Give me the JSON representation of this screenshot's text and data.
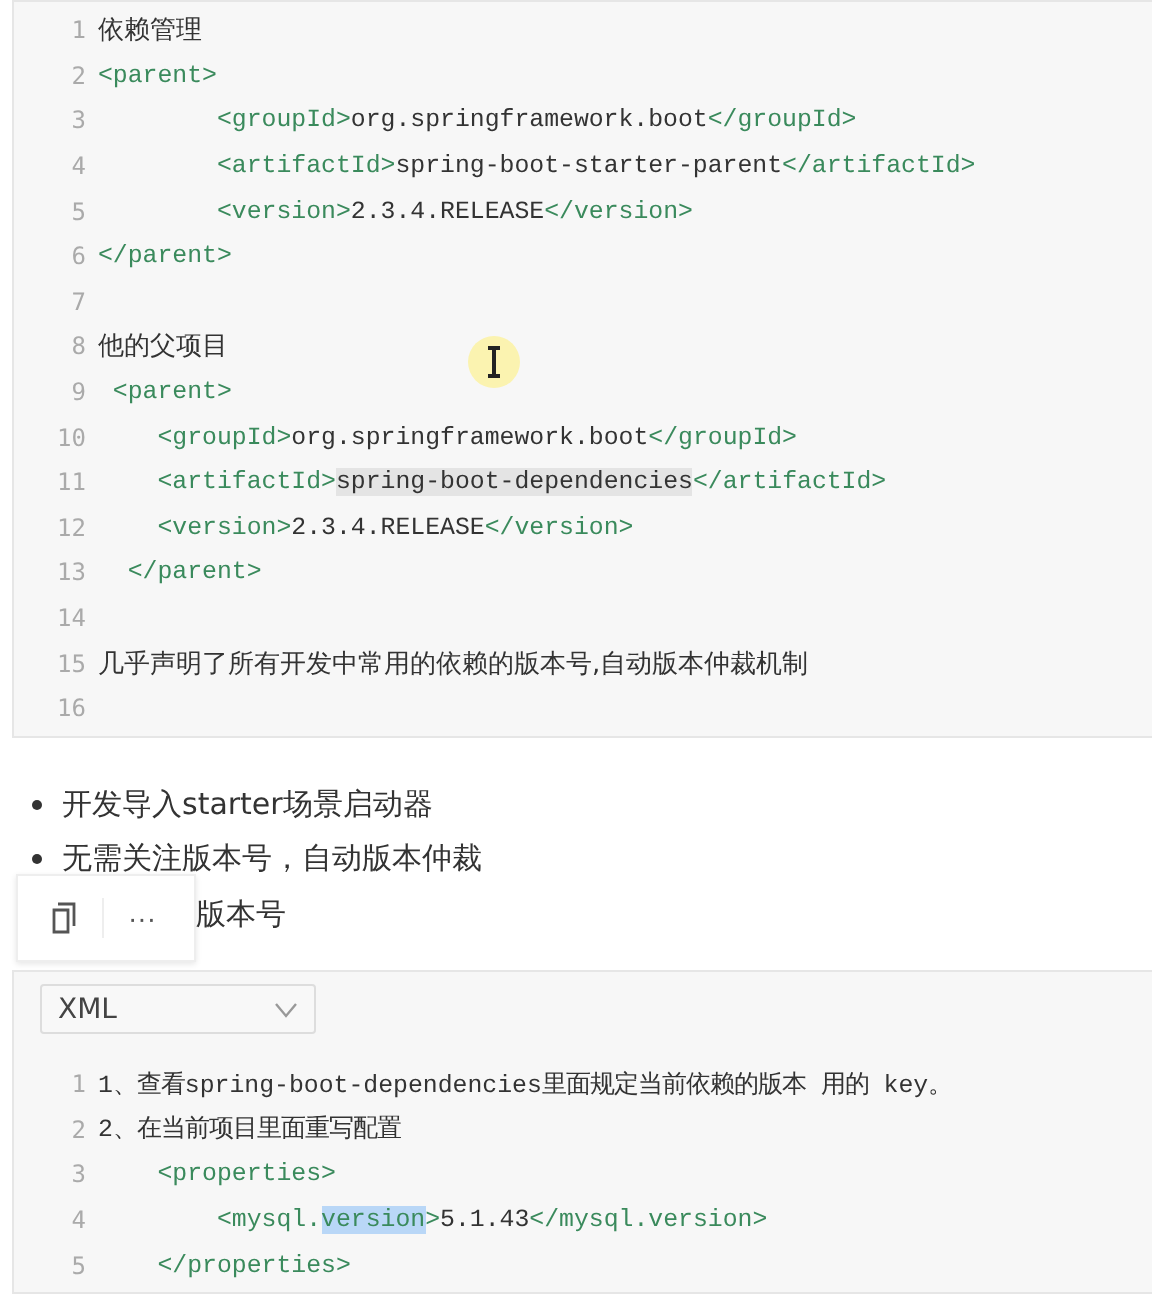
{
  "code_block_1": {
    "lines": [
      {
        "number": "1",
        "segments": [
          {
            "kind": "prose",
            "text": "依赖管理"
          }
        ]
      },
      {
        "number": "2",
        "segments": [
          {
            "kind": "tag",
            "text": "<parent>"
          }
        ]
      },
      {
        "number": "3",
        "segments": [
          {
            "kind": "tag",
            "text": "        <groupId>"
          },
          {
            "kind": "value",
            "text": "org.springframework.boot"
          },
          {
            "kind": "tag",
            "text": "</groupId>"
          }
        ]
      },
      {
        "number": "4",
        "segments": [
          {
            "kind": "tag",
            "text": "        <artifactId>"
          },
          {
            "kind": "value",
            "text": "spring-boot-starter-parent"
          },
          {
            "kind": "tag",
            "text": "</artifactId>"
          }
        ]
      },
      {
        "number": "5",
        "segments": [
          {
            "kind": "tag",
            "text": "        <version>"
          },
          {
            "kind": "value",
            "text": "2.3.4.RELEASE"
          },
          {
            "kind": "tag",
            "text": "</version>"
          }
        ]
      },
      {
        "number": "6",
        "segments": [
          {
            "kind": "tag",
            "text": "</parent>"
          }
        ]
      },
      {
        "number": "7"
      },
      {
        "number": "8",
        "segments": [
          {
            "kind": "prose",
            "text": "他的父项目"
          }
        ]
      },
      {
        "number": "9",
        "segments": [
          {
            "kind": "tag",
            "text": " <parent>"
          }
        ]
      },
      {
        "number": "10",
        "segments": [
          {
            "kind": "tag",
            "text": "    <groupId>"
          },
          {
            "kind": "value",
            "text": "org.springframework.boot"
          },
          {
            "kind": "tag",
            "text": "</groupId>"
          }
        ]
      },
      {
        "number": "11",
        "segments": [
          {
            "kind": "tag",
            "text": "    <artifactId>"
          },
          {
            "kind": "value",
            "text": "spring-boot-dependencies",
            "highlighted": true
          },
          {
            "kind": "tag",
            "text": "</artifactId>"
          }
        ]
      },
      {
        "number": "12",
        "segments": [
          {
            "kind": "tag",
            "text": "    <version>"
          },
          {
            "kind": "value",
            "text": "2.3.4.RELEASE"
          },
          {
            "kind": "tag",
            "text": "</version>"
          }
        ]
      },
      {
        "number": "13",
        "segments": [
          {
            "kind": "tag",
            "text": "  </parent>"
          }
        ]
      },
      {
        "number": "14"
      },
      {
        "number": "15",
        "segments": [
          {
            "kind": "prose",
            "text": "几乎声明了所有开发中常用的依赖的版本号,自动版本仲裁机制"
          }
        ]
      },
      {
        "number": "16"
      }
    ]
  },
  "bullets": [
    {
      "kind": "bullet",
      "text": "开发导入starter场景启动器"
    },
    {
      "kind": "bullet",
      "text": "无需关注版本号，自动版本仲裁"
    },
    {
      "kind": "covered",
      "text": "版本号"
    }
  ],
  "floating_toolbar": {
    "more": "···"
  },
  "code_block_2": {
    "language": "XML",
    "lines": [
      {
        "number": "1",
        "segments": [
          {
            "kind": "value",
            "text": "1、查看spring-boot-dependencies里面规定当前依赖的版本 用的 key。"
          }
        ]
      },
      {
        "number": "2",
        "segments": [
          {
            "kind": "value",
            "text": "2、在当前项目里面重写配置"
          }
        ]
      },
      {
        "number": "3",
        "segments": [
          {
            "kind": "tag",
            "text": "    <properties>"
          }
        ]
      },
      {
        "number": "4",
        "segments": [
          {
            "kind": "tag",
            "text": "        <mysql."
          },
          {
            "kind": "tag",
            "text": "version",
            "selected": true
          },
          {
            "kind": "tag",
            "text": ">"
          },
          {
            "kind": "value",
            "text": "5.1.43"
          },
          {
            "kind": "tag",
            "text": "</mysql.version>"
          }
        ]
      },
      {
        "number": "5",
        "segments": [
          {
            "kind": "tag",
            "text": "    </properties>"
          }
        ]
      }
    ]
  }
}
